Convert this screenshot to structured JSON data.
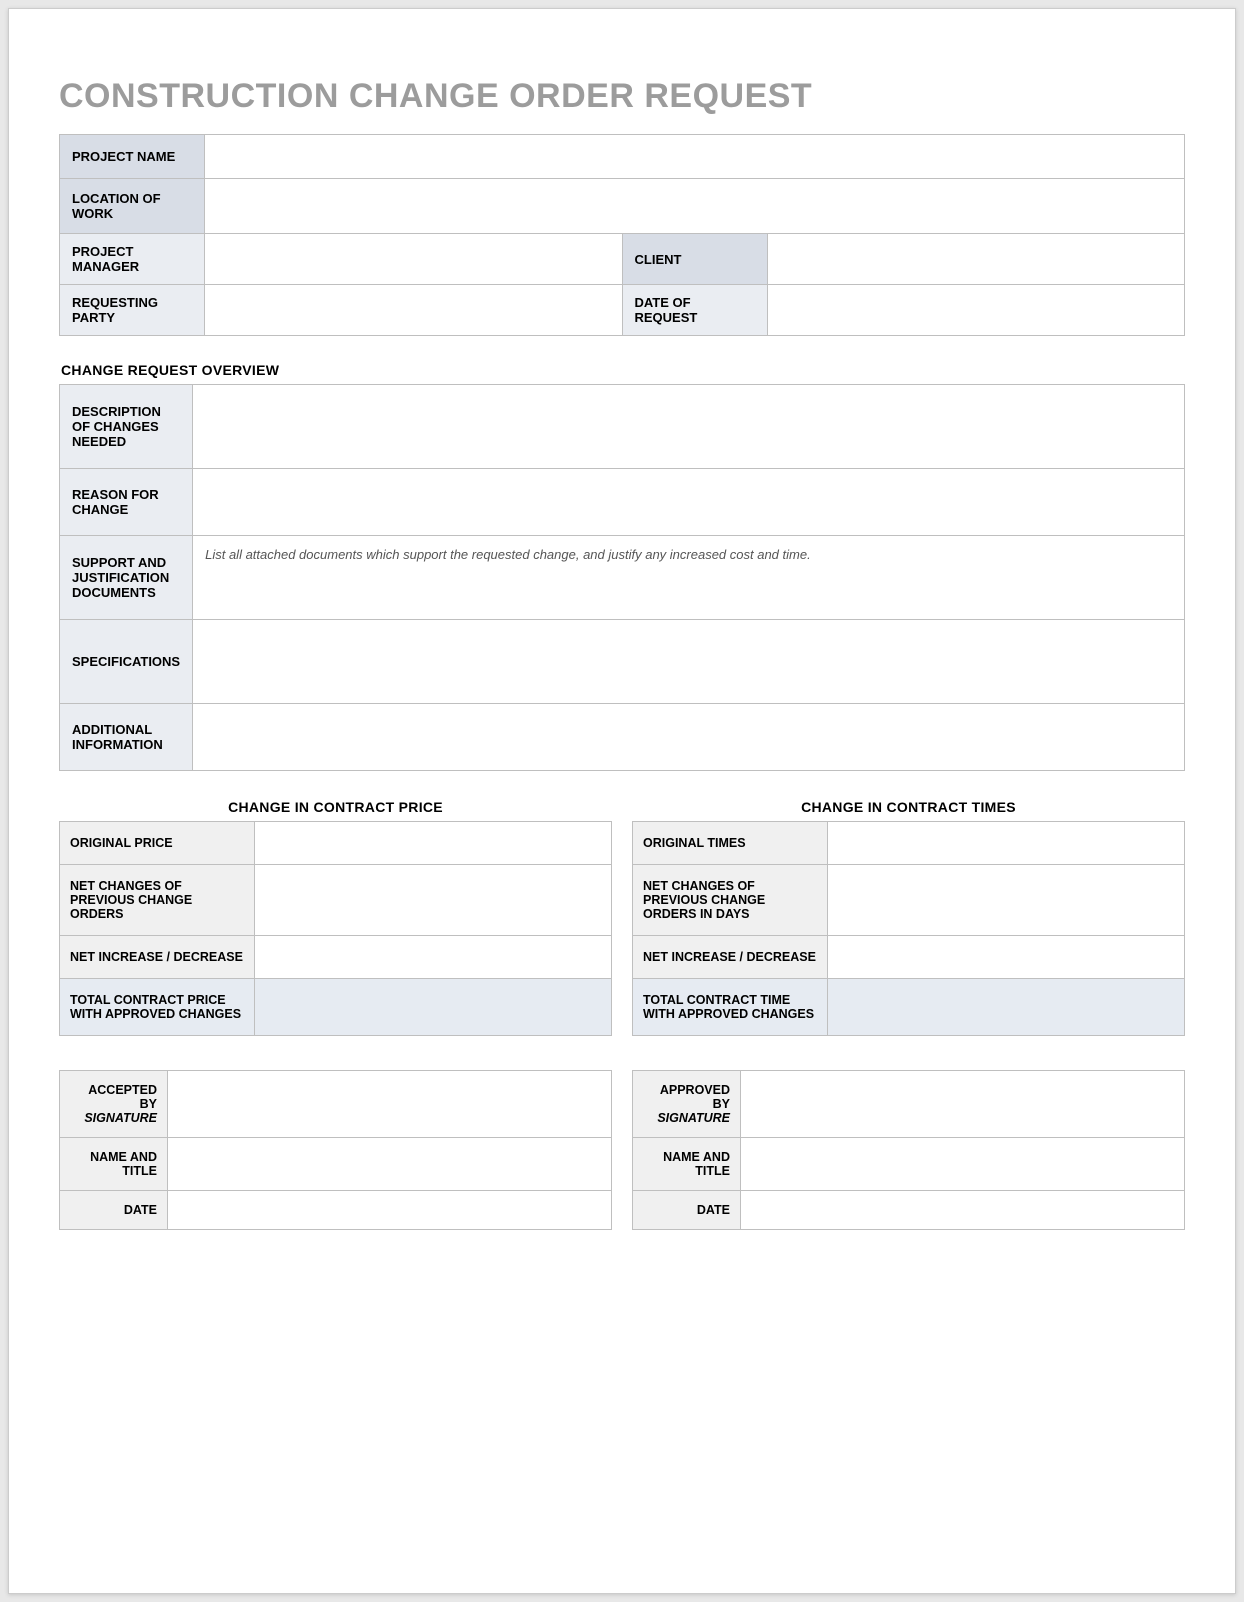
{
  "title": "CONSTRUCTION CHANGE ORDER REQUEST",
  "header": {
    "project_name_label": "PROJECT NAME",
    "project_name": "",
    "location_label": "LOCATION OF WORK",
    "location": "",
    "pm_label": "PROJECT MANAGER",
    "pm": "",
    "client_label": "CLIENT",
    "client": "",
    "req_party_label": "REQUESTING PARTY",
    "req_party": "",
    "date_label": "DATE OF REQUEST",
    "date": ""
  },
  "overview": {
    "section_title": "CHANGE REQUEST OVERVIEW",
    "desc_label": "DESCRIPTION OF CHANGES NEEDED",
    "desc": "",
    "reason_label": "REASON FOR CHANGE",
    "reason": "",
    "support_label": "SUPPORT AND JUSTIFICATION DOCUMENTS",
    "support_hint": "List all attached documents which support the requested change, and justify any increased cost and time.",
    "spec_label": "SPECIFICATIONS",
    "spec": "",
    "addl_label": "ADDITIONAL INFORMATION",
    "addl": ""
  },
  "price": {
    "title": "CHANGE IN CONTRACT PRICE",
    "orig_label": "ORIGINAL PRICE",
    "orig": "",
    "net_prev_label": "NET CHANGES OF PREVIOUS CHANGE ORDERS",
    "net_prev": "",
    "net_incdec_label": "NET INCREASE / DECREASE",
    "net_incdec": "",
    "total_label": "TOTAL CONTRACT PRICE WITH APPROVED CHANGES",
    "total": ""
  },
  "time": {
    "title": "CHANGE IN CONTRACT TIMES",
    "orig_label": "ORIGINAL TIMES",
    "orig": "",
    "net_prev_label": "NET CHANGES OF PREVIOUS CHANGE ORDERS IN DAYS",
    "net_prev": "",
    "net_incdec_label": "NET INCREASE / DECREASE",
    "net_incdec": "",
    "total_label": "TOTAL CONTRACT TIME WITH APPROVED CHANGES",
    "total": ""
  },
  "sig_left": {
    "by_label": "ACCEPTED BY",
    "by_sub": "SIGNATURE",
    "by": "",
    "name_label": "NAME AND TITLE",
    "name": "",
    "date_label": "DATE",
    "date": ""
  },
  "sig_right": {
    "by_label": "APPROVED BY",
    "by_sub": "SIGNATURE",
    "by": "",
    "name_label": "NAME AND TITLE",
    "name": "",
    "date_label": "DATE",
    "date": ""
  }
}
